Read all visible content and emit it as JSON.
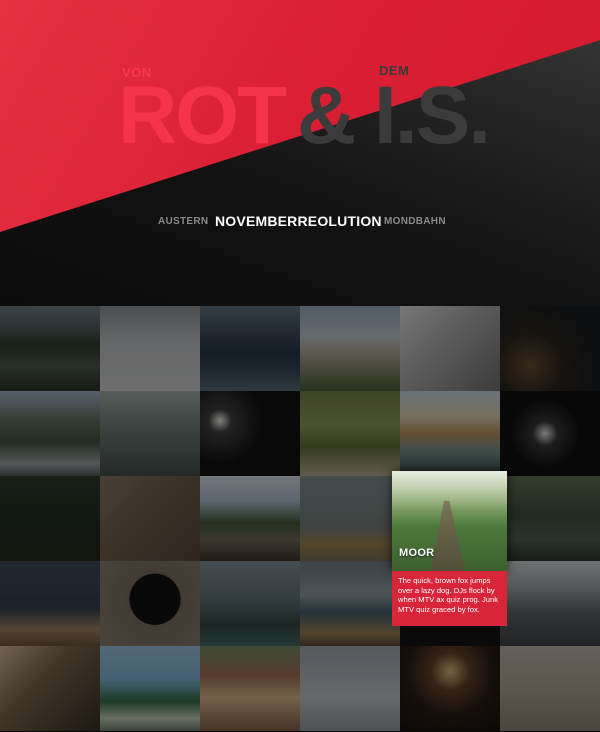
{
  "title": {
    "von": "VON",
    "dem": "DEM",
    "logo_rot": "ROT",
    "logo_amp": "&",
    "logo_is": "I.S."
  },
  "nav": {
    "prev": "AUSTERN",
    "current": "NOVEMBERREOLUTION",
    "next": "MONDBAHN"
  },
  "gallery": {
    "active": {
      "label": "MOOR",
      "caption": "The quick, brown fox jumps over a lazy dog. DJs flock by when MTV ax quiz prog. Junk MTV quiz graced by fox."
    }
  },
  "colors": {
    "accent_red": "#d9253a",
    "logo_red": "#f5334d",
    "logo_dark": "#3b3b3b"
  }
}
